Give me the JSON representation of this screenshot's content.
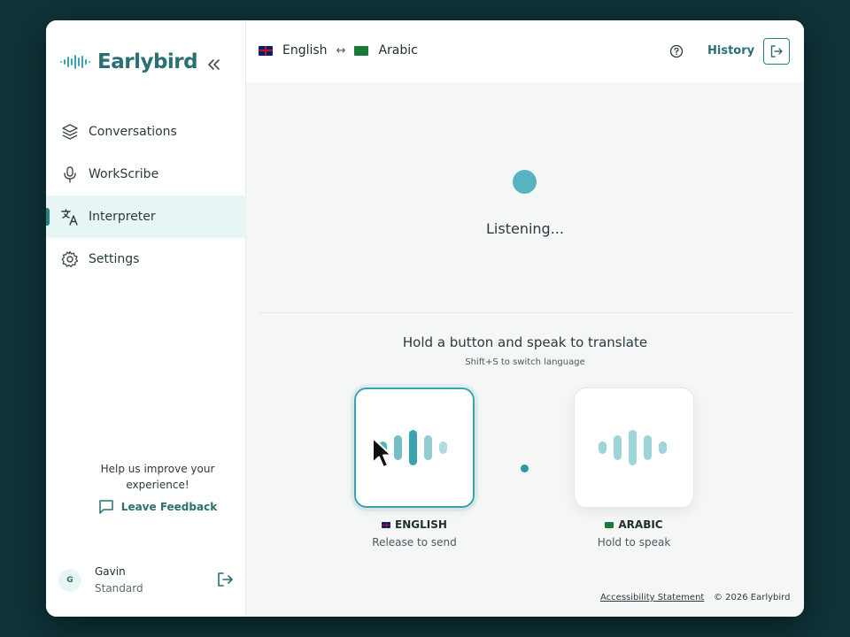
{
  "brand": {
    "name": "Earlybird",
    "accent": "#2a6f73",
    "icon": "waveform-logo-icon"
  },
  "sidebar": {
    "collapse_icon": "chevrons-left-icon",
    "items": [
      {
        "label": "Conversations",
        "icon": "layers-icon",
        "active": false
      },
      {
        "label": "WorkScribe",
        "icon": "microphone-icon",
        "active": false
      },
      {
        "label": "Interpreter",
        "icon": "translate-icon",
        "active": true
      },
      {
        "label": "Settings",
        "icon": "gear-icon",
        "active": false
      }
    ],
    "feedback": {
      "text": "Help us improve your experience!",
      "link_label": "Leave Feedback"
    },
    "user": {
      "initial": "G",
      "name": "Gavin",
      "plan": "Standard"
    }
  },
  "topbar": {
    "source_language": "English",
    "target_language": "Arabic",
    "swap_symbol": "↔",
    "history_label": "History"
  },
  "main": {
    "status_text": "Listening...",
    "instruction_title": "Hold a button and speak to translate",
    "instruction_sub": "Shift+S to switch language",
    "buttons": [
      {
        "language": "ENGLISH",
        "hint": "Release to send",
        "state": "pressed"
      },
      {
        "language": "ARABIC",
        "hint": "Hold to speak",
        "state": "idle"
      }
    ]
  },
  "footer": {
    "accessibility_label": "Accessibility Statement",
    "copyright": "© 2026 Earlybird"
  },
  "colors": {
    "background": "#0e3338",
    "active_nav": "#e7f5f5",
    "listening_dot": "#56b3bf",
    "wave_active": "#3aa3ad",
    "wave_idle": "#9fd4d9"
  }
}
